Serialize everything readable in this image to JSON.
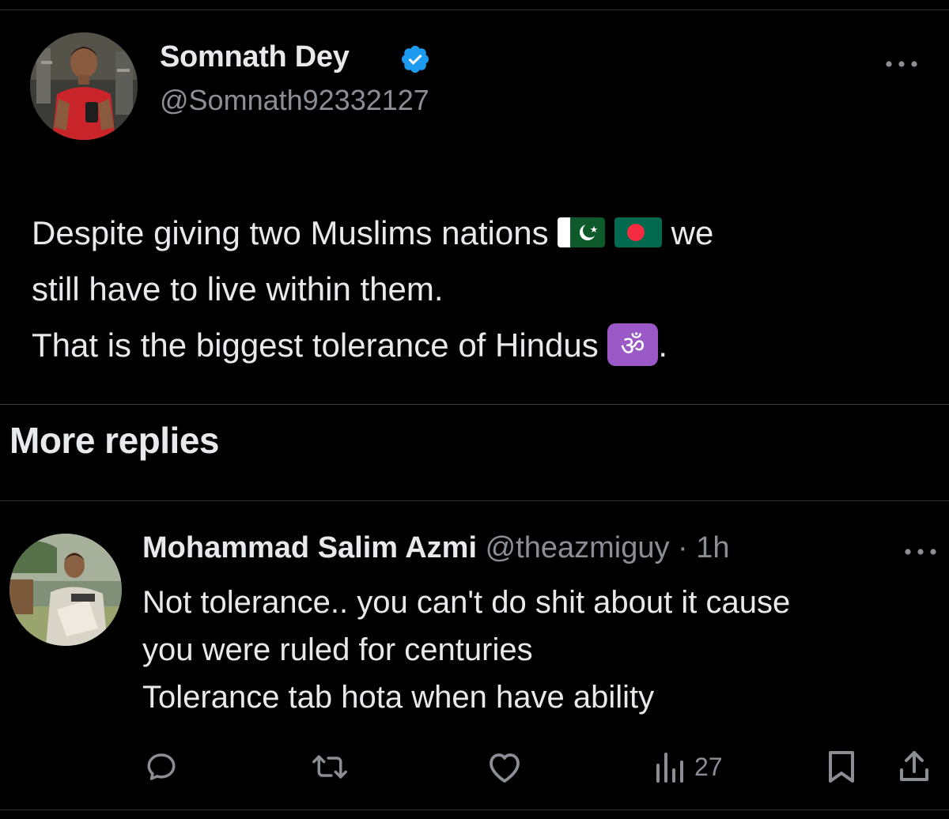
{
  "main_tweet": {
    "author_name": "Somnath Dey",
    "author_handle": "@Somnath92332127",
    "verified": true,
    "text_line1_before": "Despite giving two Muslims nations",
    "text_line1_after": "we",
    "text_line2": "still have to live within them.",
    "text_line3_before": "That is the biggest tolerance of Hindus",
    "text_line3_after": ".",
    "emoji": [
      "pakistan-flag",
      "bangladesh-flag",
      "om-symbol"
    ]
  },
  "section": {
    "title": "More replies"
  },
  "reply": {
    "author_name": "Mohammad Salim Azmi",
    "author_handle": "@theazmiguy",
    "separator": "·",
    "time": "1h",
    "lines": [
      "Not tolerance.. you can't do shit about it cause",
      "you were ruled for centuries",
      "Tolerance tab hota when have ability"
    ],
    "views": "27"
  },
  "actions": [
    "reply-icon",
    "retweet-icon",
    "like-icon",
    "views-icon",
    "bookmark-icon",
    "share-icon"
  ],
  "colors": {
    "background": "#000000",
    "text": "#e7e9ea",
    "muted": "#8b8f94",
    "verified_blue": "#1d9bf0",
    "divider": "#2f3336"
  }
}
